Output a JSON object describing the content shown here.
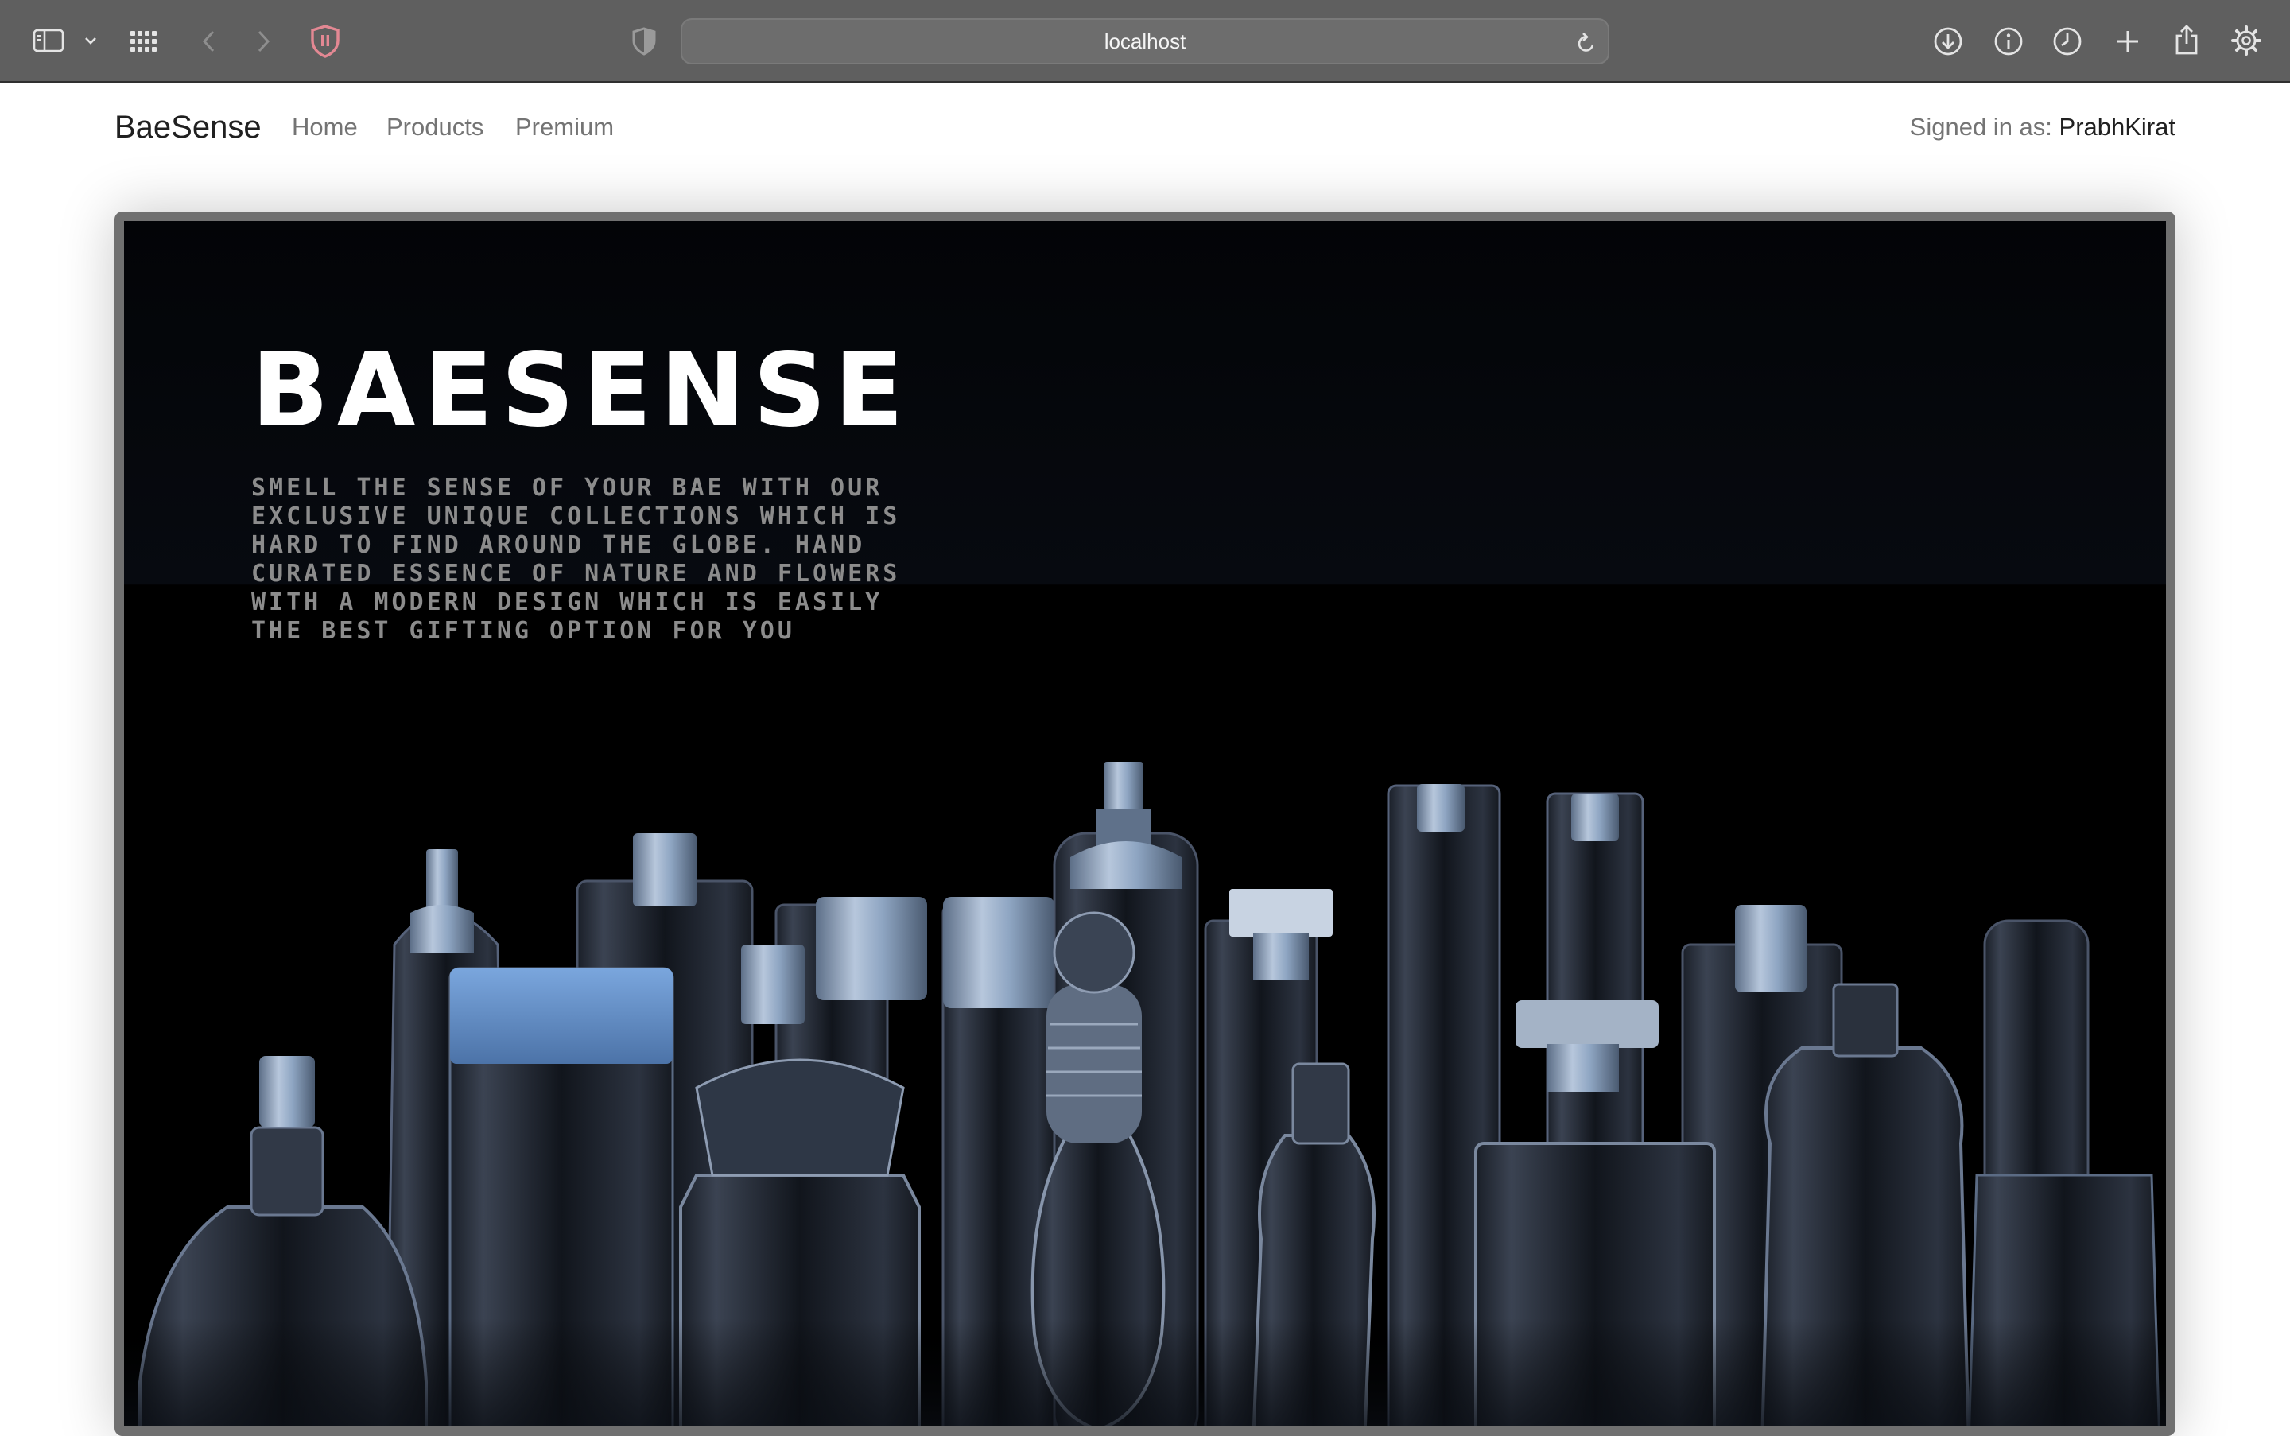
{
  "browser": {
    "url": "localhost",
    "icons": {
      "sidebar": "sidebar-icon",
      "sidebar_menu": "chevron-down-icon",
      "tab_overview": "grid-icon",
      "back": "back-arrow-icon",
      "forward": "forward-arrow-icon",
      "extension": "shield-icon",
      "privacy": "privacy-shield-icon",
      "reload": "reload-icon",
      "downloads": "download-icon",
      "info": "info-icon",
      "history": "clock-icon",
      "new_tab": "plus-icon",
      "share": "share-icon",
      "settings": "gear-icon"
    }
  },
  "nav": {
    "brand": "BaeSense",
    "links": [
      "Home",
      "Products",
      "Premium"
    ],
    "signed_in_label": "Signed in as:",
    "user": "PrabhKirat"
  },
  "hero": {
    "title": "BAESENSE",
    "text": "SMELL THE SENSE OF YOUR BAE WITH OUR EXCLUSIVE UNIQUE COLLECTIONS WHICH IS HARD TO FIND AROUND THE GLOBE. HAND CURATED ESSENCE OF NATURE AND FLOWERS WITH A MODERN DESIGN WHICH IS EASILY THE BEST GIFTING OPTION FOR YOU",
    "image": "perfume-bottles-image"
  },
  "colors": {
    "chrome": "#5f5f5f",
    "hero_bg": "#000000",
    "accent_blue": "#6f9fd8",
    "extension_red": "#e0707a"
  }
}
